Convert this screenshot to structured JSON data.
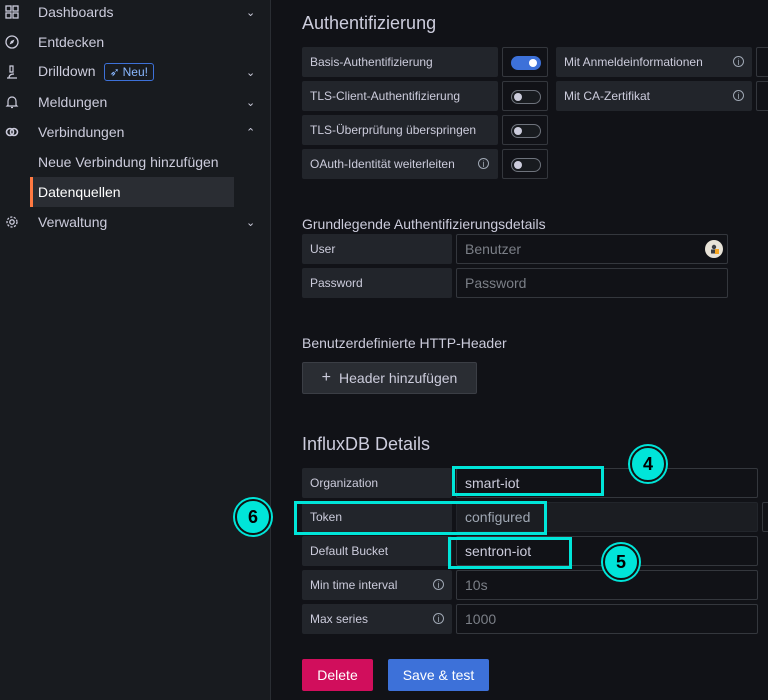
{
  "sidebar": {
    "items": [
      {
        "label": "Dashboards",
        "icon": "grid-icon",
        "chevron": "⌄"
      },
      {
        "label": "Entdecken",
        "icon": "compass-icon"
      },
      {
        "label": "Drilldown",
        "icon": "microscope-icon",
        "badge": "Neu!",
        "chevron": "⌄"
      },
      {
        "label": "Meldungen",
        "icon": "bell-icon",
        "chevron": "⌄"
      },
      {
        "label": "Verbindungen",
        "icon": "link-icon",
        "chevron": "⌃"
      },
      {
        "label": "Neue Verbindung hinzufügen"
      },
      {
        "label": "Datenquellen"
      },
      {
        "label": "Verwaltung",
        "icon": "gear-icon",
        "chevron": "⌄"
      }
    ]
  },
  "auth": {
    "title": "Authentifizierung",
    "basic_auth": "Basis-Authentifizierung",
    "basic_auth_on": true,
    "with_credentials": "Mit Anmeldeinformationen",
    "tls_client": "TLS-Client-Authentifizierung",
    "with_ca": "Mit CA-Zertifikat",
    "tls_skip": "TLS-Überprüfung überspringen",
    "oauth_forward": "OAuth-Identität weiterleiten"
  },
  "basic_details": {
    "title": "Grundlegende Authentifizierungsdetails",
    "user_label": "User",
    "user_placeholder": "Benutzer",
    "password_label": "Password",
    "password_placeholder": "Password"
  },
  "headers": {
    "title": "Benutzerdefinierte HTTP-Header",
    "add_button": "Header hinzufügen",
    "plus": "+"
  },
  "influx": {
    "title": "InfluxDB Details",
    "org_label": "Organization",
    "org_value": "smart-iot",
    "token_label": "Token",
    "token_value": "configured",
    "bucket_label": "Default Bucket",
    "bucket_value": "sentron-iot",
    "min_interval_label": "Min time interval",
    "min_interval_placeholder": "10s",
    "max_series_label": "Max series",
    "max_series_placeholder": "1000"
  },
  "actions": {
    "delete": "Delete",
    "save": "Save & test"
  },
  "callouts": {
    "c4": "4",
    "c5": "5",
    "c6": "6"
  },
  "colors": {
    "accent": "#3d71d9",
    "danger": "#d10e5c",
    "highlight": "#00e5d9",
    "active_marker": "#ff7941"
  }
}
